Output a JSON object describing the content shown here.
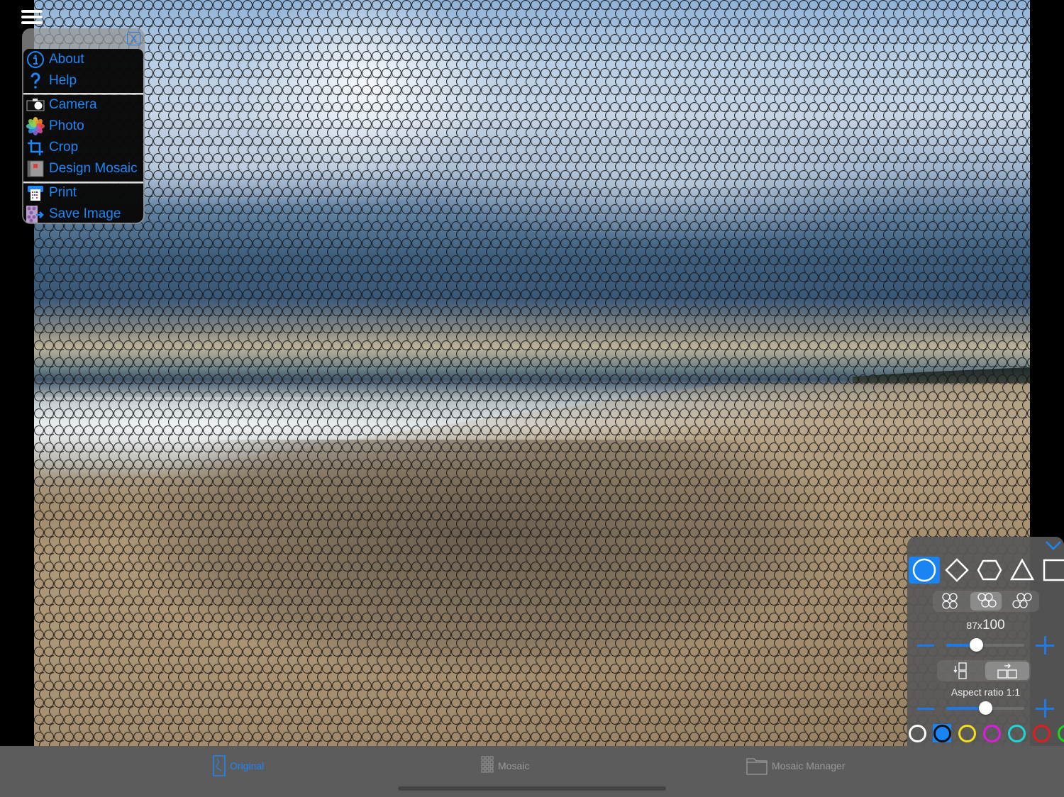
{
  "menu": {
    "close_label": "X",
    "items": [
      {
        "label": "About",
        "icon": "info-icon"
      },
      {
        "label": "Help",
        "icon": "question-icon"
      },
      {
        "label": "Camera",
        "icon": "camera-icon"
      },
      {
        "label": "Photo",
        "icon": "photos-icon"
      },
      {
        "label": "Crop",
        "icon": "crop-icon"
      },
      {
        "label": "Design Mosaic",
        "icon": "design-mosaic-icon"
      },
      {
        "label": "Print",
        "icon": "printer-icon"
      },
      {
        "label": "Save Image",
        "icon": "save-image-icon"
      }
    ]
  },
  "panel": {
    "shapes": [
      "circle",
      "diamond",
      "hexagon",
      "triangle",
      "square"
    ],
    "selected_shape": "circle",
    "layouts": [
      "square-grid",
      "offset-grid",
      "staggered-grid"
    ],
    "selected_layout": "offset-grid",
    "size_label_small": "87x",
    "size_label_big": "100",
    "size_slider_value": 0.38,
    "orientation_options": [
      "vertical",
      "horizontal"
    ],
    "selected_orientation": "horizontal",
    "aspect_label": "Aspect ratio  1:1",
    "aspect_slider_value": 0.5,
    "colors": [
      {
        "name": "white",
        "hex": "#ffffff"
      },
      {
        "name": "blue",
        "hex": "#1a84f2"
      },
      {
        "name": "yellow",
        "hex": "#f2e01a"
      },
      {
        "name": "magenta",
        "hex": "#e01ae0"
      },
      {
        "name": "cyan",
        "hex": "#1ad8d8"
      },
      {
        "name": "red",
        "hex": "#e81a1a"
      },
      {
        "name": "green",
        "hex": "#1ad81a"
      }
    ],
    "selected_color": "blue"
  },
  "tabs": [
    {
      "label": "Original",
      "icon": "original-image-icon",
      "active": true
    },
    {
      "label": "Mosaic",
      "icon": "mosaic-grid-icon",
      "active": false
    },
    {
      "label": "Mosaic Manager",
      "icon": "folder-icon",
      "active": false
    }
  ],
  "theme": {
    "accent": "#1f86f7",
    "tab_inactive": "#9a9a9a",
    "tabbar_bg": "#5c5c5c"
  }
}
